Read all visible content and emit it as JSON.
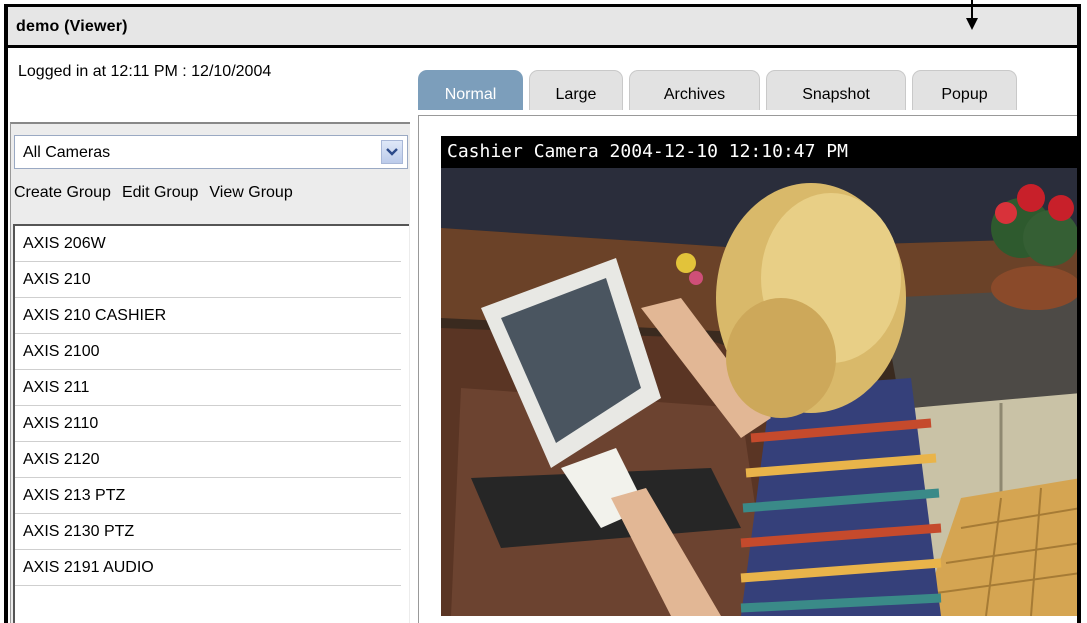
{
  "window": {
    "title": "demo (Viewer)"
  },
  "session": {
    "logged_in_text": "Logged in at 12:11 PM : 12/10/2004"
  },
  "tabs": [
    {
      "label": "Normal",
      "active": true
    },
    {
      "label": "Large",
      "active": false
    },
    {
      "label": "Archives",
      "active": false
    },
    {
      "label": "Snapshot",
      "active": false
    },
    {
      "label": "Popup",
      "active": false
    }
  ],
  "sidebar": {
    "camera_select": {
      "value": "All Cameras",
      "icon": "chevron-down-icon"
    },
    "group_buttons": {
      "create": "Create Group",
      "edit": "Edit Group",
      "view": "View Group"
    },
    "cameras": [
      "AXIS 206W",
      "AXIS 210",
      "AXIS 210 CASHIER",
      "AXIS 2100",
      "AXIS 211",
      "AXIS 2110",
      "AXIS 2120",
      "AXIS 213 PTZ",
      "AXIS 2130 PTZ",
      "AXIS 2191 AUDIO"
    ]
  },
  "video": {
    "overlay_text": "Cashier Camera 2004-12-10 12:10:47 PM"
  },
  "colors": {
    "active_tab": "#7c9ebb",
    "inactive_tab": "#e2e2e2",
    "titlebar": "#e6e6e6"
  }
}
